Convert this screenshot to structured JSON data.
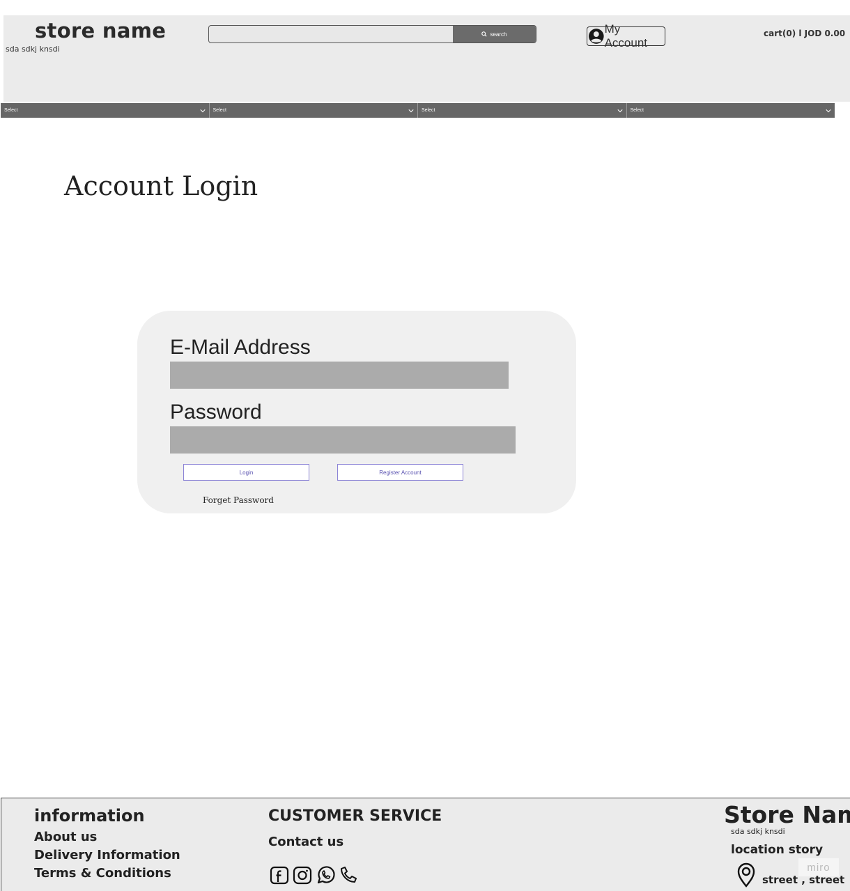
{
  "header": {
    "store_name": "store name",
    "tagline": "sda sdkj knsdi",
    "search": {
      "placeholder": "",
      "button_label": "search"
    },
    "account_label": "My Account",
    "cart_label": "cart(0) l  JOD 0.00"
  },
  "nav": {
    "selects": [
      {
        "value": "Select"
      },
      {
        "value": "Select"
      },
      {
        "value": "Select"
      },
      {
        "value": "Select"
      }
    ]
  },
  "page": {
    "title": "Account Login"
  },
  "login": {
    "email_label": "E-Mail Address",
    "email_value": "",
    "password_label": "Password",
    "password_value": "",
    "login_button": "Login",
    "register_button": "Register Account",
    "forgot_link": "Forget Password"
  },
  "footer": {
    "information": {
      "heading": "information",
      "links": [
        "About us",
        "Delivery Information",
        "Terms & Conditions"
      ]
    },
    "customer_service": {
      "heading": "CUSTOMER SERVICE",
      "contact": "Contact us",
      "social_icons": [
        "facebook-icon",
        "instagram-icon",
        "whatsapp-icon",
        "phone-icon"
      ]
    },
    "store": {
      "name": "Store Name",
      "tagline": "sda sdkj knsdi",
      "location_heading": "location story",
      "address": "street , street"
    },
    "watermark": "miro"
  },
  "colors": {
    "header_bg": "#ebebeb",
    "nav_bg": "#666666",
    "search_button_bg": "#6b6b6b",
    "input_fill": "#ababab",
    "card_bg": "#f0f0f0",
    "button_border": "#8c84d6"
  }
}
